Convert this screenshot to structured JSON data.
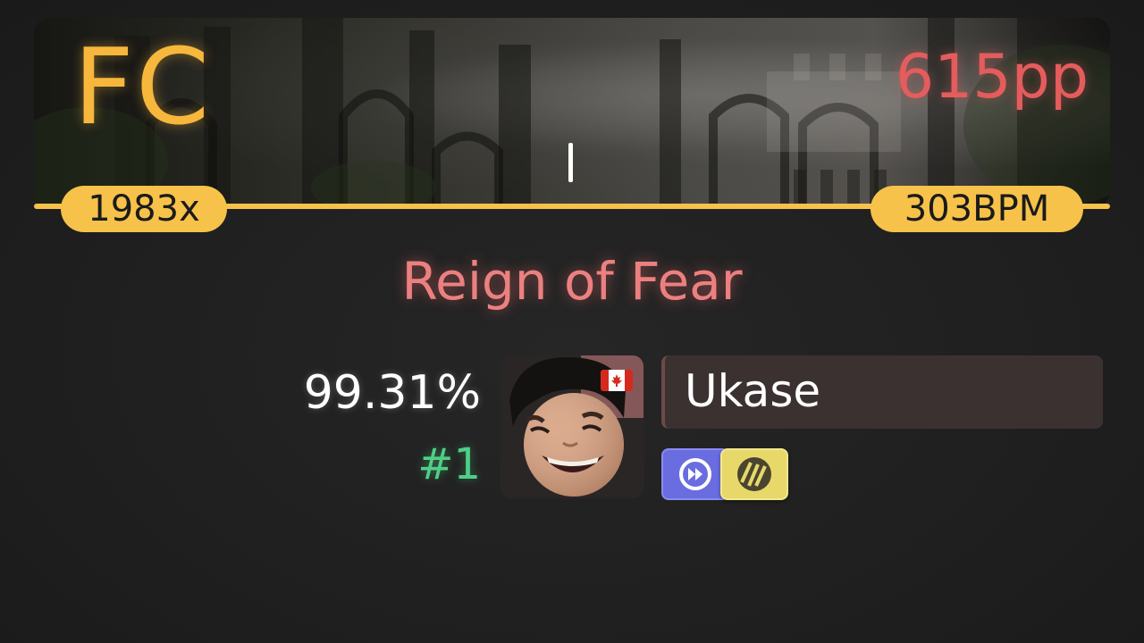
{
  "score_banner": {
    "rank": "FC",
    "pp": "615pp",
    "combo": "1983x",
    "bpm": "303BPM",
    "cursor_glyph": "|"
  },
  "beatmap": {
    "title": "Reign of Fear"
  },
  "play": {
    "accuracy": "99.31%",
    "leaderboard_rank": "#1"
  },
  "player": {
    "username": "Ukase",
    "country_flag": "canada-flag-icon",
    "avatar": "player-avatar-face"
  },
  "mods": [
    {
      "name": "double-time-mod-icon",
      "color": "#6a6de0"
    },
    {
      "name": "hard-rock-mod-icon",
      "color": "#e8d86a"
    }
  ],
  "colors": {
    "accent_gold": "#f7c24a",
    "rank_color": "#f6b73c",
    "pp_color": "#e45c5c",
    "title_color": "#ec8080",
    "rank_num_color": "#4fcf86",
    "username_bg": "#3c3131"
  }
}
